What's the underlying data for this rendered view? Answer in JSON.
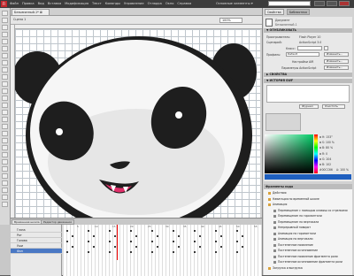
{
  "app": {
    "logo": "Fl",
    "menu": [
      "Файл",
      "Правка",
      "Вид",
      "Вставка",
      "Модификация",
      "Текст",
      "Команды",
      "Управление",
      "Отладка",
      "Окно",
      "Справка"
    ],
    "workspace": "Основные элементы ▾",
    "search_placeholder": ""
  },
  "document": {
    "tab": "Безымянный-1* ⊠",
    "scene": "Сцена 1",
    "zoom": "100%"
  },
  "properties": {
    "tabs": [
      "Свойства",
      "Библиотека"
    ],
    "doc_label": "Документ",
    "doc_name": "Безымянный-1",
    "sec_publish": "▼ ОПУБЛИКОВАТЬ",
    "player_label": "Проигрыватель:",
    "player_value": "Flash Player 10",
    "script_label": "Сценарий:",
    "script_value": "ActionScript 3.0",
    "class_label": "Класс:",
    "profile_label": "Профиль:",
    "profile_value": "Default",
    "profile_btn": "Изменить...",
    "air_label": "Настройки AIR",
    "air_btn": "Изменить...",
    "as_label": "Параметры ActionScript",
    "as_btn": "Изменить...",
    "sec_props": "▶ СВОЙСТВА",
    "sec_swf": "▼ ИСТОРИЯ SWF",
    "log_btn": "Журнал",
    "clear_btn": "Очистить"
  },
  "color": {
    "values": [
      {
        "k": "H:",
        "v": "153°"
      },
      {
        "k": "S:",
        "v": "100 %"
      },
      {
        "k": "B:",
        "v": "80 %"
      },
      {
        "k": "R:",
        "v": "0"
      },
      {
        "k": "G:",
        "v": "204"
      },
      {
        "k": "B:",
        "v": "102"
      }
    ],
    "hex": "#00CC66",
    "alpha": "A: 100 %",
    "accent": "#00cc66"
  },
  "library": {
    "title": "Фрагменты кода",
    "items": [
      "Действия",
      "Навигация по временной шкале",
      "Анимация",
      "Перемещение с помощью клавиш со стрелками",
      "Перемещение по горизонтали",
      "Перемещение по вертикали",
      "Непрерывный поворот",
      "Анимация по горизонтали",
      "Анимация по вертикали",
      "Постепенное появление",
      "Постепенное исчезновение",
      "Постепенное появление фрагмента роли",
      "Постепенное исчезновение фрагмента роли",
      "Загрузка и выгрузка"
    ]
  },
  "timeline": {
    "tabs": [
      "Временная шкала",
      "Редактор движения"
    ],
    "layers": [
      "Глаза",
      "Рот",
      "Голова",
      "Уши",
      "Фон"
    ],
    "frame_numbers": [
      "5",
      "10",
      "15",
      "20",
      "25",
      "30",
      "35",
      "40",
      "45",
      "50",
      "55"
    ]
  }
}
